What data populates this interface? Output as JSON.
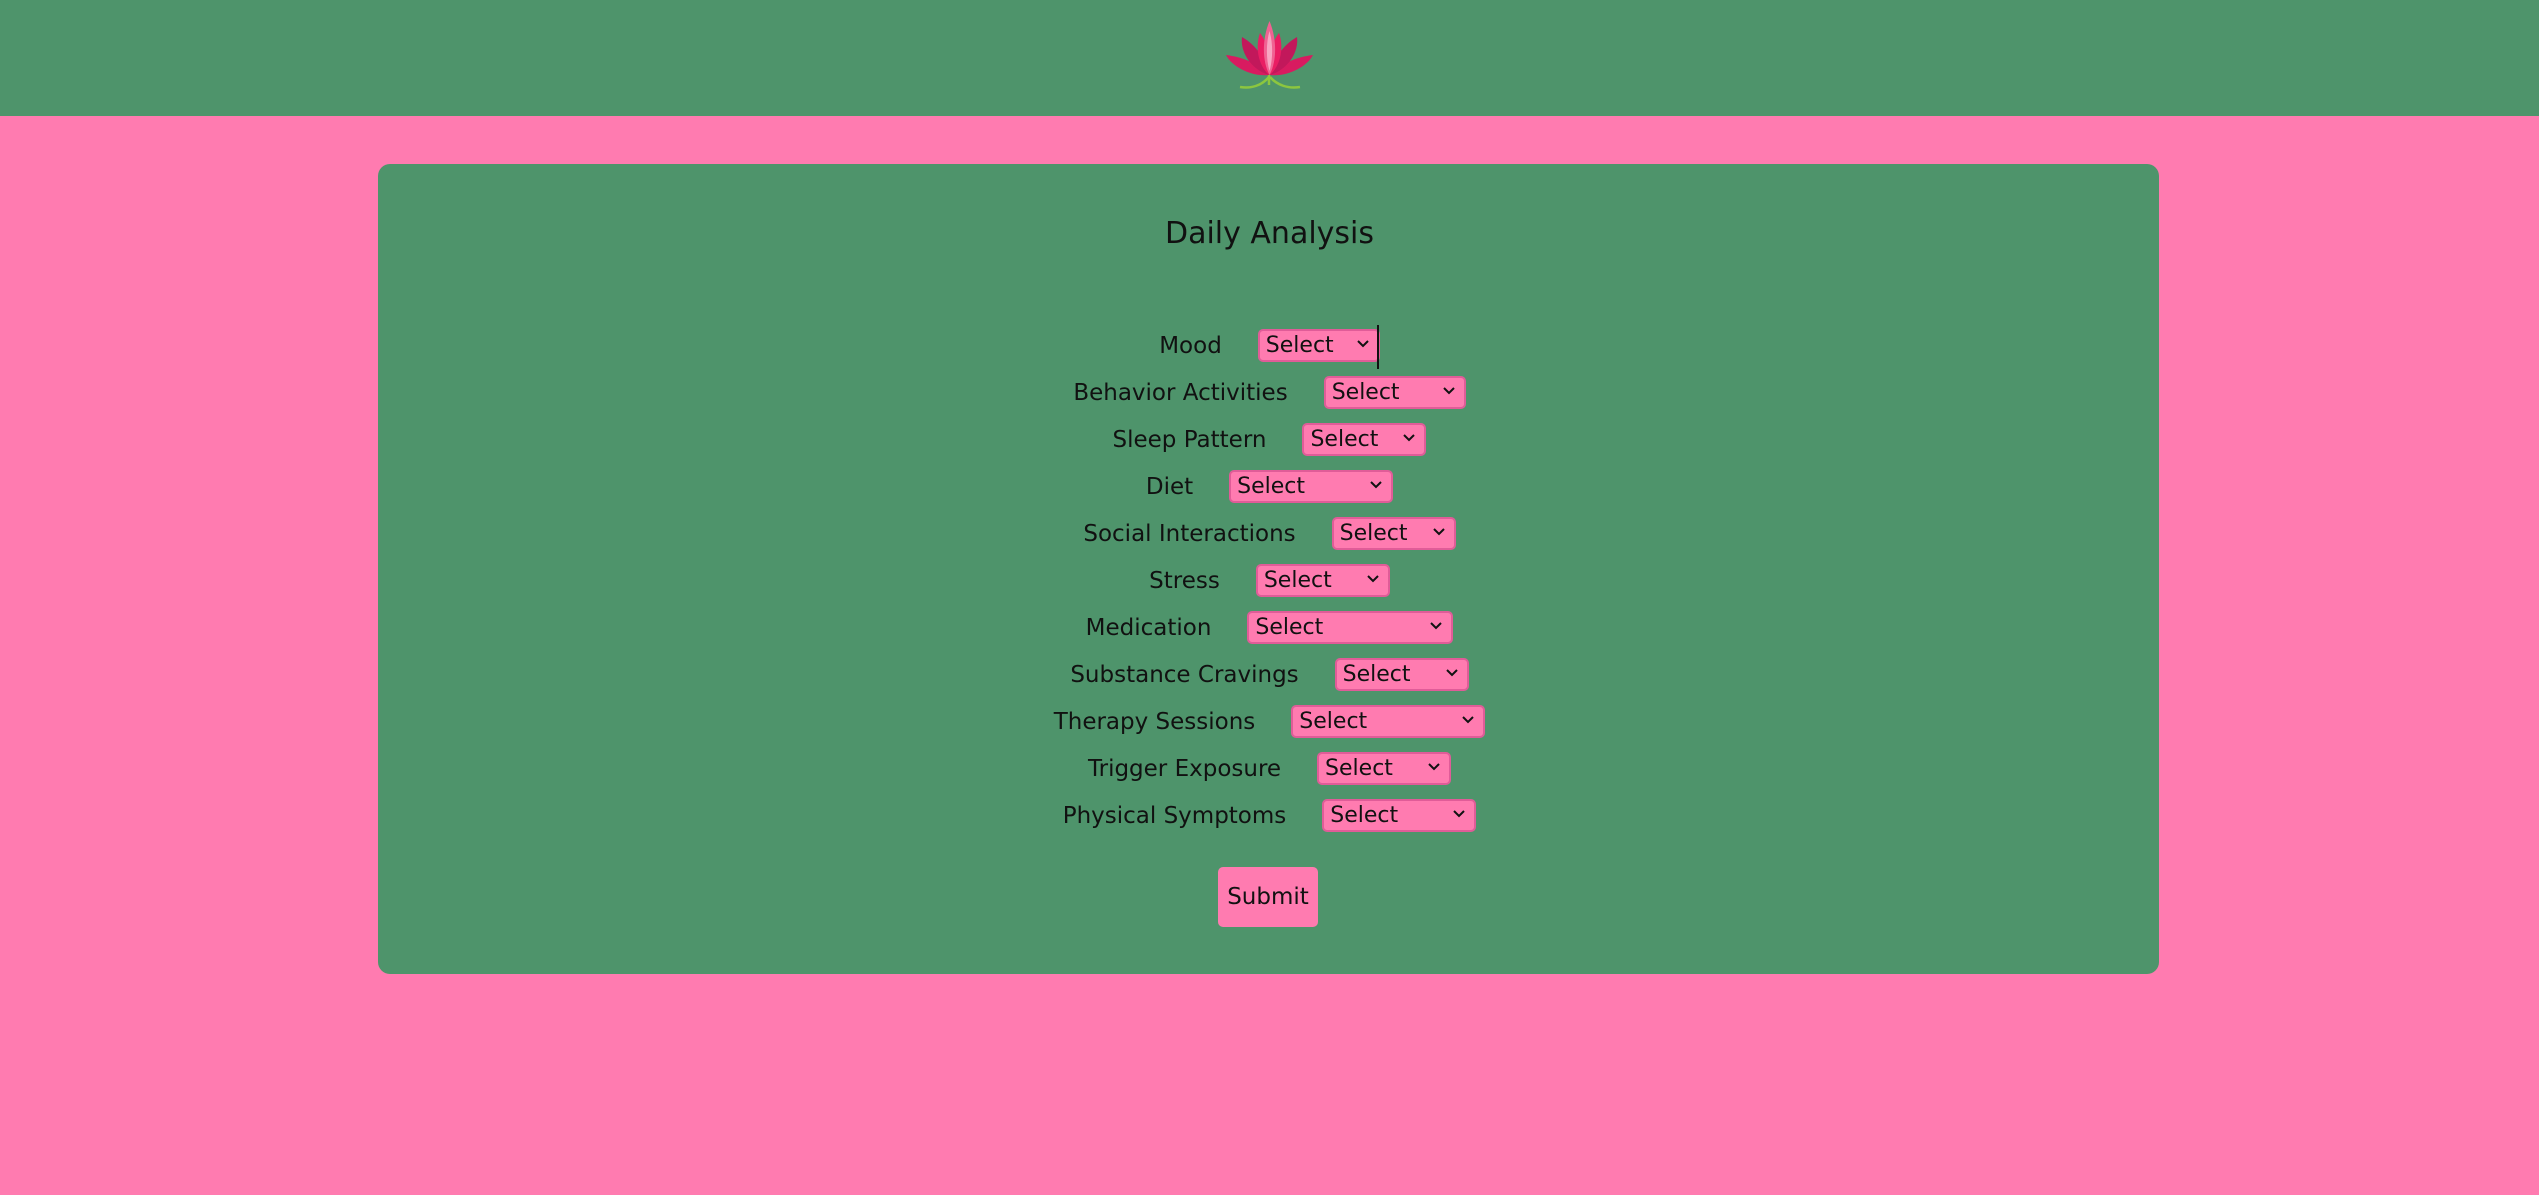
{
  "header": {
    "logo_icon": "lotus-icon",
    "background": "#4e946b"
  },
  "form": {
    "title": "Daily Analysis",
    "fields": [
      {
        "label": "Mood",
        "value": "Select"
      },
      {
        "label": "Behavior Activities",
        "value": "Select"
      },
      {
        "label": "Sleep Pattern",
        "value": "Select"
      },
      {
        "label": "Diet",
        "value": "Select"
      },
      {
        "label": "Social Interactions",
        "value": "Select"
      },
      {
        "label": "Stress",
        "value": "Select"
      },
      {
        "label": "Medication",
        "value": "Select"
      },
      {
        "label": "Substance Cravings",
        "value": "Select"
      },
      {
        "label": "Therapy Sessions",
        "value": "Select"
      },
      {
        "label": "Trigger Exposure",
        "value": "Select"
      },
      {
        "label": "Physical Symptoms",
        "value": "Select"
      }
    ],
    "submit_label": "Submit"
  },
  "colors": {
    "page_background": "#ff7bb0",
    "panel": "#4e946b",
    "control": "#ff7bb0"
  }
}
